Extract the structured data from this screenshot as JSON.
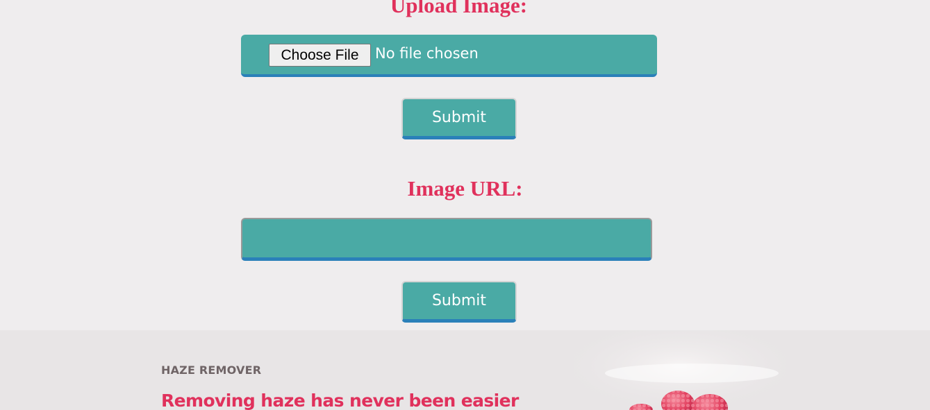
{
  "upload": {
    "heading": "Upload Image:",
    "choose_file_label": "Choose File",
    "file_status": "No file chosen",
    "submit_label": "Submit"
  },
  "url": {
    "heading": "Image URL:",
    "value": "",
    "submit_label": "Submit"
  },
  "feature": {
    "eyebrow": "HAZE REMOVER",
    "title": "Removing haze has never been easier",
    "image_icon": "raspberries-photo"
  },
  "colors": {
    "background": "#efedee",
    "accent_pink": "#e0315c",
    "teal": "#4aaaa5",
    "blue_underline": "#2a80b9",
    "section_background": "#e8e5e6"
  }
}
